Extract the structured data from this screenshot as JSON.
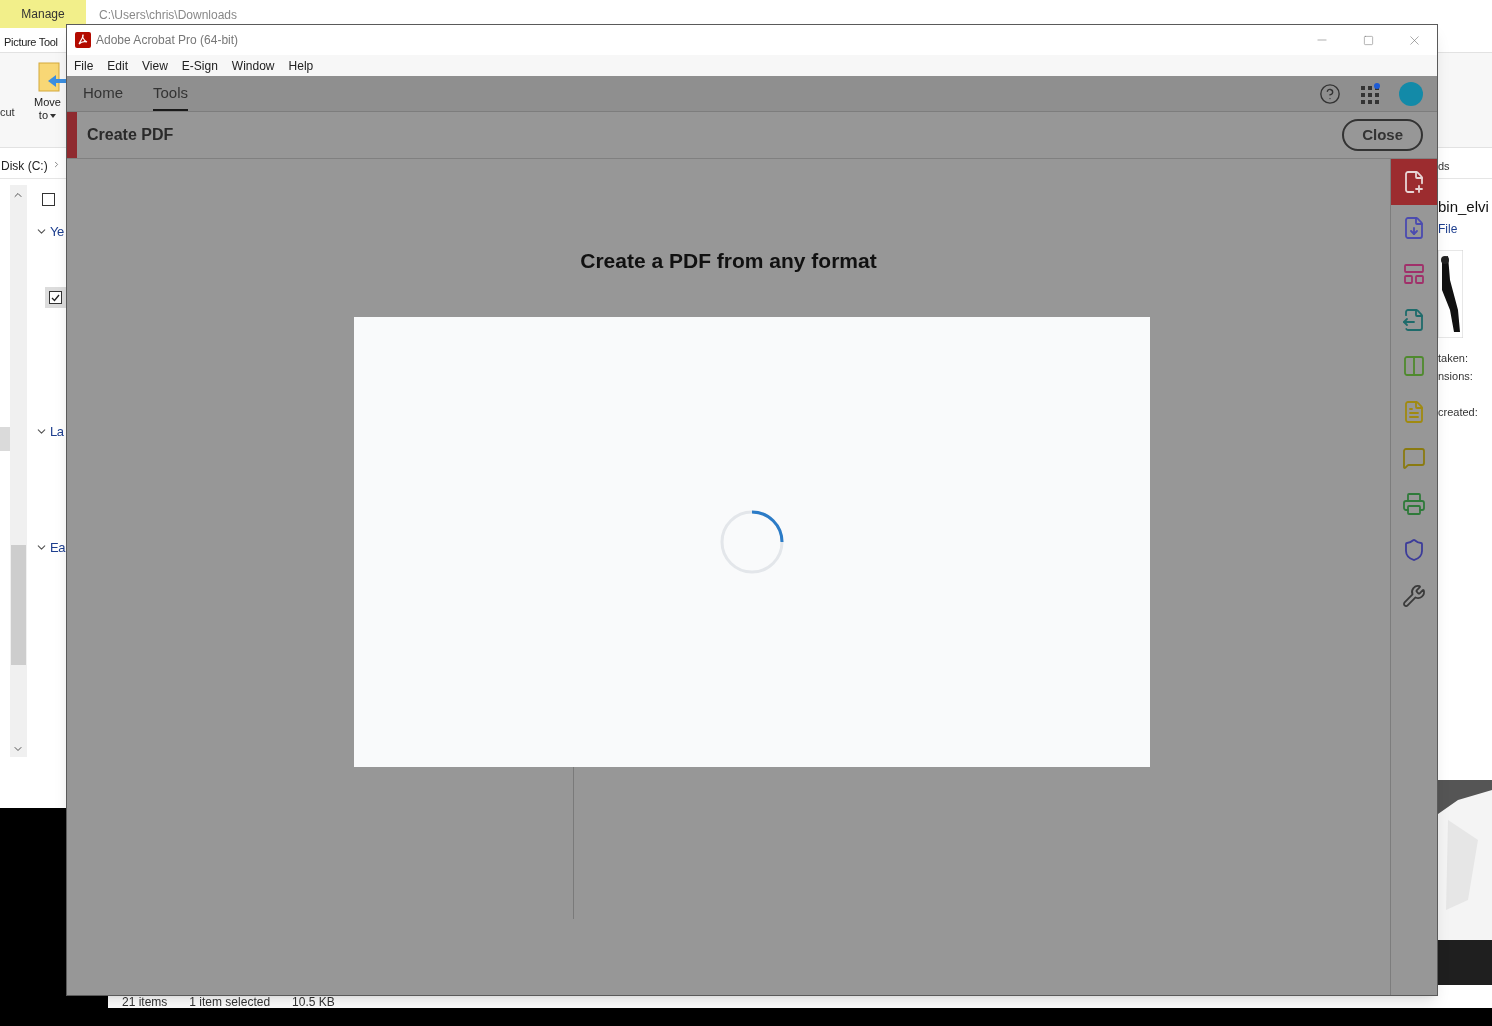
{
  "explorer": {
    "ribbon_tab": "Manage",
    "path": "C:\\Users\\chris\\Downloads",
    "ribbon_label": "Picture Tool",
    "cut_label": "cut",
    "move_label": "Move",
    "move_sub": "to",
    "breadcrumb": "Disk (C:)",
    "checkboxes": [
      {
        "checked": false
      },
      {
        "checked": true
      }
    ],
    "groups": [
      {
        "label": "Ye",
        "expanded": true
      },
      {
        "label": "La",
        "expanded": true
      },
      {
        "label": "Ea",
        "expanded": true
      }
    ],
    "details": {
      "header": "ds",
      "name": "bin_elvi",
      "type": "File",
      "fields": [
        "taken:",
        "nsions:",
        "created:"
      ]
    },
    "status": [
      "21 items",
      "1 item selected",
      "10.5 KB"
    ]
  },
  "acrobat": {
    "title": "Adobe Acrobat Pro (64-bit)",
    "menu": [
      "File",
      "Edit",
      "View",
      "E-Sign",
      "Window",
      "Help"
    ],
    "tabs": [
      {
        "label": "Home",
        "selected": false
      },
      {
        "label": "Tools",
        "selected": true
      }
    ],
    "tool_title": "Create PDF",
    "close_button": "Close",
    "heading": "Create a PDF from any format",
    "tools": [
      {
        "kind": "create",
        "color": "#e8d6d6",
        "selected": true
      },
      {
        "kind": "export",
        "color": "#4b4bb0",
        "selected": false
      },
      {
        "kind": "organize",
        "color": "#a0306a",
        "selected": false
      },
      {
        "kind": "convert",
        "color": "#1e6b6b",
        "selected": false
      },
      {
        "kind": "compare",
        "color": "#4f8a2e",
        "selected": false
      },
      {
        "kind": "edit",
        "color": "#a08a10",
        "selected": false
      },
      {
        "kind": "comment",
        "color": "#8a7a10",
        "selected": false
      },
      {
        "kind": "scan",
        "color": "#2f7a3a",
        "selected": false
      },
      {
        "kind": "protect",
        "color": "#3c3c9a",
        "selected": false
      },
      {
        "kind": "more",
        "color": "#3a3a3a",
        "selected": false
      }
    ]
  }
}
